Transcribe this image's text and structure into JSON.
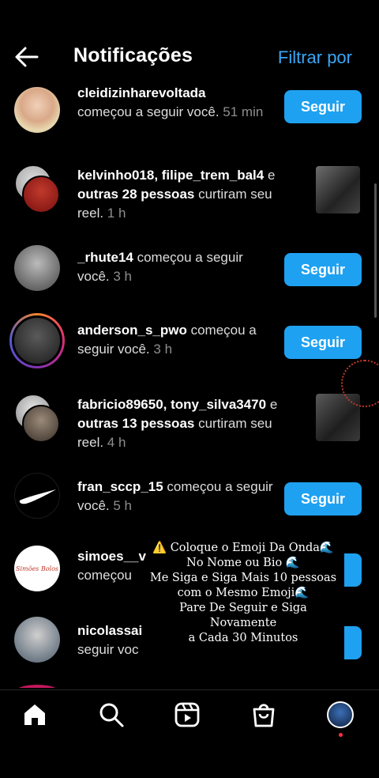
{
  "header": {
    "title": "Notificações",
    "filter_label": "Filtrar por"
  },
  "notifications": [
    {
      "bold": "cleidizinharevoltada",
      "text": " começou a seguir você.",
      "time": " 51 min",
      "action": "Seguir"
    },
    {
      "bold": "kelvinho018, filipe_trem_bal4",
      "mid": " e ",
      "bold2": "outras 28 pessoas",
      "text": " curtiram seu reel.",
      "time": " 1 h"
    },
    {
      "bold": "_rhute14",
      "text": " começou a seguir você.",
      "time": " 3 h",
      "action": "Seguir"
    },
    {
      "bold": "anderson_s_pwo",
      "text": " começou a seguir você.",
      "time": " 3 h",
      "action": "Seguir"
    },
    {
      "bold": "fabricio89650, tony_silva3470",
      "mid": " e ",
      "bold2": "outras 13 pessoas",
      "text": " curtiram seu reel.",
      "time": " 4 h"
    },
    {
      "bold": "fran_sccp_15",
      "text": " começou a seguir você.",
      "time": " 5 h",
      "action": "Seguir"
    },
    {
      "bold": "simoes__v",
      "text": "começou"
    },
    {
      "bold": "nicolassai",
      "text": "seguir voc"
    }
  ],
  "avatar_caption": "Simões Bolos",
  "overlay": {
    "line1": "⚠️ Coloque o Emoji Da Onda🌊",
    "line2": "No Nome ou Bio 🌊",
    "line3": "Me Siga e Siga Mais 10 pessoas",
    "line4": "com o Mesmo Emoji🌊",
    "line5": "Pare De Seguir e Siga",
    "line6": "Novamente",
    "line7": "a Cada 30 Minutos"
  },
  "nav": [
    "home-icon",
    "search-icon",
    "reels-icon",
    "shop-icon",
    "profile-avatar"
  ],
  "colors": {
    "accent": "#1fa1f1",
    "background": "#000000",
    "link": "#3aa6f5"
  }
}
